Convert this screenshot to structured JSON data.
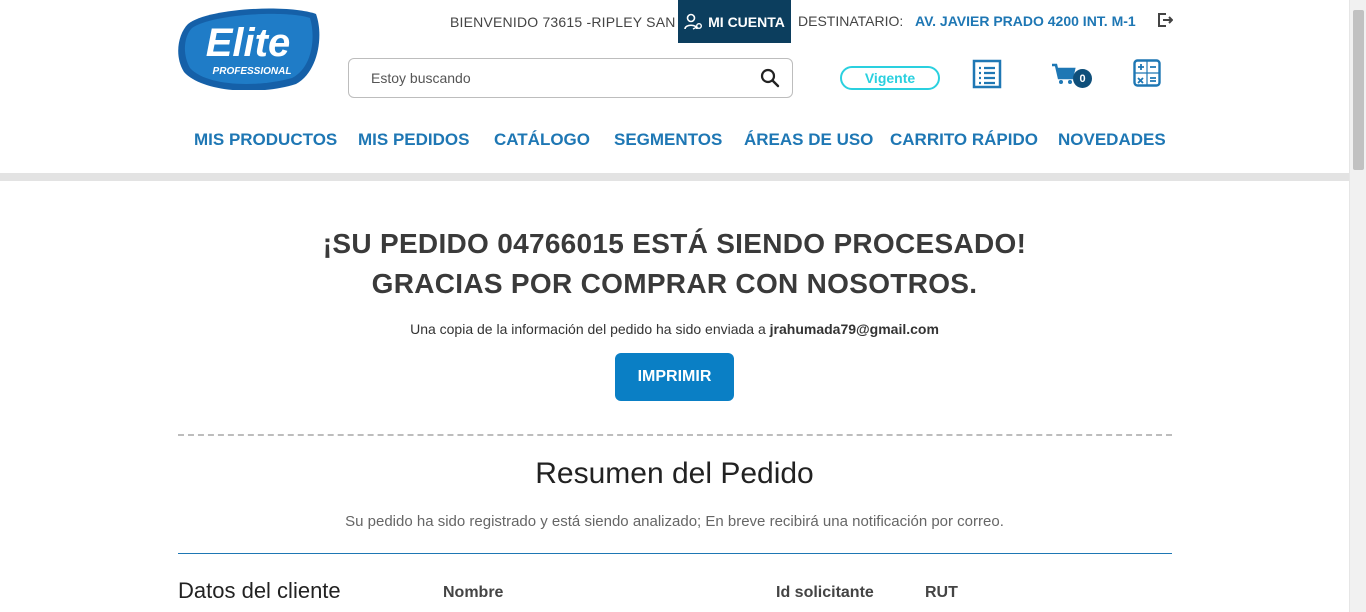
{
  "brand": {
    "logo_text": "Elite",
    "logo_subtext": "PROFESSIONAL",
    "colors": {
      "primary": "#1e77b4",
      "dark": "#0c3e5e",
      "accent": "#2ad0df",
      "button": "#0a7fc5"
    }
  },
  "topbar": {
    "welcome": "BIENVENIDO 73615 -RIPLEY SAN",
    "account_label": "MI CUENTA",
    "recipient_label": "DESTINATARIO:",
    "recipient_value": "AV. JAVIER PRADO 4200 INT. M-1",
    "logout_icon": "logout-icon"
  },
  "search": {
    "placeholder": "Estoy buscando",
    "icon": "search-icon"
  },
  "status_badge": "Vigente",
  "cart": {
    "count": "0"
  },
  "nav": [
    {
      "label": "MIS PRODUCTOS"
    },
    {
      "label": "MIS PEDIDOS"
    },
    {
      "label": "CATÁLOGO"
    },
    {
      "label": "SEGMENTOS"
    },
    {
      "label": "ÁREAS DE USO"
    },
    {
      "label": "CARRITO RÁPIDO"
    },
    {
      "label": "NOVEDADES"
    }
  ],
  "confirmation": {
    "line1": "¡SU PEDIDO 04766015 ESTÁ SIENDO PROCESADO!",
    "line2": "GRACIAS POR COMPRAR CON NOSOTROS.",
    "copy_text": "Una copia de la información del pedido ha sido enviada a",
    "email": "jrahumada79@gmail.com",
    "print_label": "IMPRIMIR"
  },
  "summary": {
    "title": "Resumen del Pedido",
    "subtitle": "Su pedido ha sido registrado y está siendo analizado; En breve recibirá una notificación por correo."
  },
  "client": {
    "title": "Datos del cliente",
    "columns": [
      "Nombre",
      "Id solicitante",
      "RUT"
    ]
  }
}
